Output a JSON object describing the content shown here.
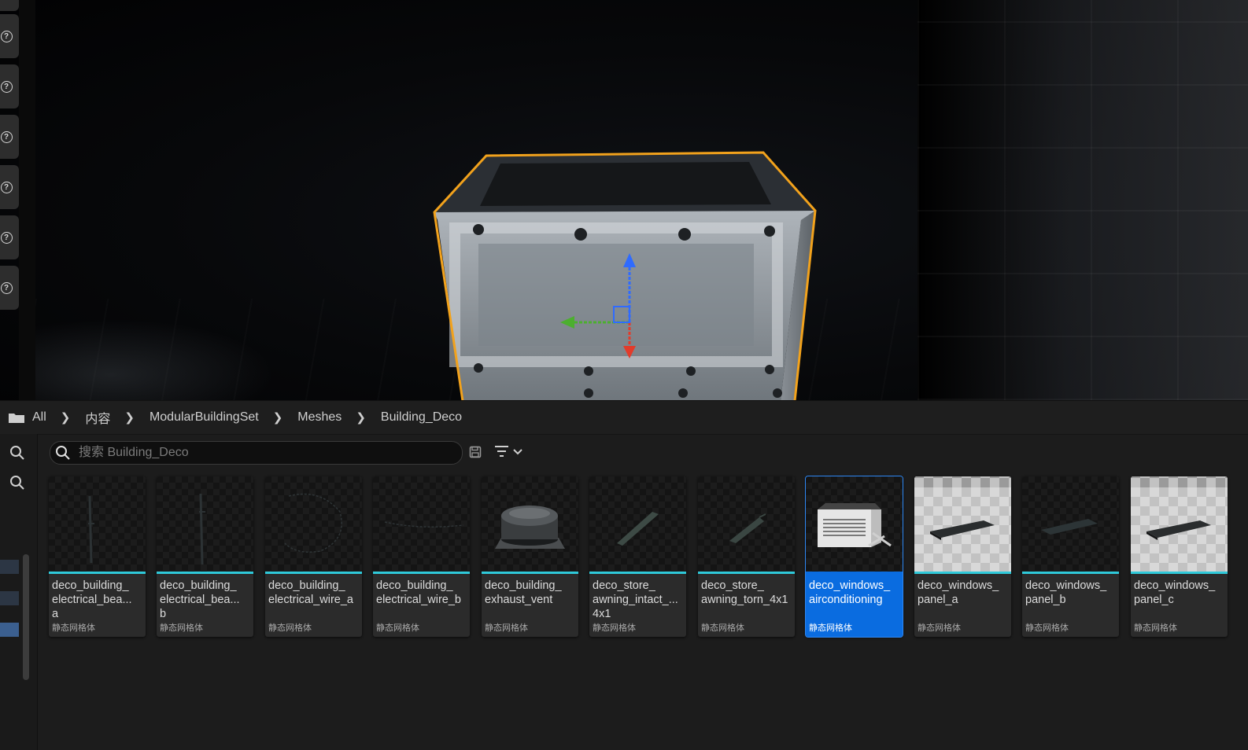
{
  "breadcrumb": {
    "items": [
      "All",
      "内容",
      "ModularBuildingSet",
      "Meshes",
      "Building_Deco"
    ]
  },
  "search": {
    "placeholder": "搜索 Building_Deco",
    "value": ""
  },
  "assets": [
    {
      "name_lines": [
        "deco_building_",
        "electrical_bea...",
        "a"
      ],
      "type": "静态网格体",
      "selected": false
    },
    {
      "name_lines": [
        "deco_building_",
        "electrical_bea...",
        "b"
      ],
      "type": "静态网格体",
      "selected": false
    },
    {
      "name_lines": [
        "deco_building_",
        "electrical_wire_a"
      ],
      "type": "静态网格体",
      "selected": false
    },
    {
      "name_lines": [
        "deco_building_",
        "electrical_wire_b"
      ],
      "type": "静态网格体",
      "selected": false
    },
    {
      "name_lines": [
        "deco_building_",
        "exhaust_vent"
      ],
      "type": "静态网格体",
      "selected": false
    },
    {
      "name_lines": [
        "deco_store_",
        "awning_intact_...",
        "4x1"
      ],
      "type": "静态网格体",
      "selected": false
    },
    {
      "name_lines": [
        "deco_store_",
        "awning_torn_4x1"
      ],
      "type": "静态网格体",
      "selected": false
    },
    {
      "name_lines": [
        "deco_windows_",
        "airconditioning"
      ],
      "type": "静态网格体",
      "selected": true
    },
    {
      "name_lines": [
        "deco_windows_",
        "panel_a"
      ],
      "type": "静态网格体",
      "selected": false
    },
    {
      "name_lines": [
        "deco_windows_",
        "panel_b"
      ],
      "type": "静态网格体",
      "selected": false
    },
    {
      "name_lines": [
        "deco_windows_",
        "panel_c"
      ],
      "type": "静态网格体",
      "selected": false
    }
  ],
  "colors": {
    "selection": "#0a6ce0",
    "asset_type_bar": "#2fc9d9",
    "viewport_outline": "#f2a21c"
  }
}
